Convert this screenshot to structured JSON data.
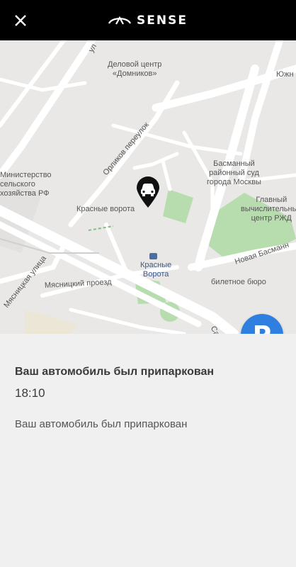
{
  "header": {
    "close_icon": "close-icon",
    "brand_logo_icon": "infiniti-logo-icon",
    "brand_name": "SENSE"
  },
  "map": {
    "labels": {
      "delovoy_center": "Деловой центр\n«Домников»",
      "ministry": "Министерство\nсельского\nхозяйства РФ",
      "krasnye_vorota": "Красные ворота",
      "metro": "Красные\nВорота",
      "basmanny_court": "Басманный\nрайонный суд\nгорода Москвы",
      "rzd": "Главный\nвычислительный\nцентр РЖД",
      "ticket_office": "билетное бюро",
      "yuzh": "Южн"
    },
    "streets": {
      "orlikov": "Орликов переулок",
      "myasnitskaya": "Мясницкая улица",
      "myasnitsky_proezd": "Мясницкий проезд",
      "novaya_basmannaya": "Новая Басманн",
      "top_street": "ул",
      "sad": "Сад"
    },
    "marker_icon": "car-marker-icon"
  },
  "parking_button": {
    "label": "P",
    "color": "#2f7fe0"
  },
  "info": {
    "title": "Ваш автомобиль был припаркован",
    "time": "18:10",
    "description": "Ваш автомобиль был припаркован"
  }
}
